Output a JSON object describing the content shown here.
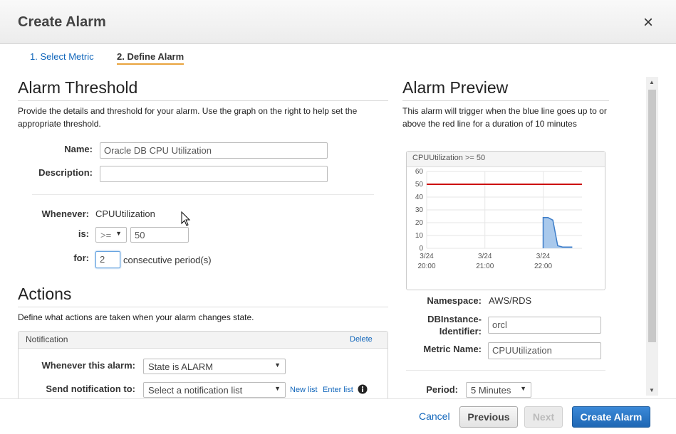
{
  "dialog": {
    "title": "Create Alarm",
    "close": "×"
  },
  "steps": [
    {
      "label": "1. Select Metric"
    },
    {
      "label": "2. Define Alarm"
    }
  ],
  "threshold": {
    "heading": "Alarm Threshold",
    "description": "Provide the details and threshold for your alarm. Use the graph on the right to help set the appropriate threshold.",
    "name_label": "Name:",
    "name_value": "Oracle DB CPU Utilization",
    "description_label": "Description:",
    "description_value": "",
    "whenever_label": "Whenever:",
    "whenever_value": "CPUUtilization",
    "is_label": "is:",
    "operator": ">=",
    "threshold_value": "50",
    "for_label": "for:",
    "periods_value": "2",
    "periods_suffix": "consecutive period(s)"
  },
  "actions": {
    "heading": "Actions",
    "description": "Define what actions are taken when your alarm changes state.",
    "notification": {
      "title": "Notification",
      "delete": "Delete",
      "whenever_label": "Whenever this alarm:",
      "state_value": "State is ALARM",
      "send_label": "Send notification to:",
      "send_value": "Select a notification list",
      "new_list": "New list",
      "enter_list": "Enter list"
    }
  },
  "preview": {
    "heading": "Alarm Preview",
    "description": "This alarm will trigger when the blue line goes up to or above the red line for a duration of 10 minutes",
    "namespace_label": "Namespace:",
    "namespace_value": "AWS/RDS",
    "dbinstance_label_1": "DBInstance-",
    "dbinstance_label_2": "Identifier:",
    "dbinstance_value": "orcl",
    "metric_label": "Metric Name:",
    "metric_value": "CPUUtilization",
    "period_label": "Period:",
    "period_value": "5 Minutes"
  },
  "footer": {
    "cancel": "Cancel",
    "previous": "Previous",
    "next": "Next",
    "create": "Create Alarm"
  },
  "colors": {
    "threshold_line": "#cc0000",
    "metric_line": "#3d7dc8",
    "metric_fill": "#a9c9ec",
    "accent_underline": "#e8a33d",
    "primary_button": "#2a75c4"
  },
  "chart_data": {
    "type": "area",
    "title": "CPUUtilization >= 50",
    "x_ticks": [
      {
        "date": "3/24",
        "time": "20:00"
      },
      {
        "date": "3/24",
        "time": "21:00"
      },
      {
        "date": "3/24",
        "time": "22:00"
      }
    ],
    "y_ticks": [
      0,
      10,
      20,
      30,
      40,
      50,
      60
    ],
    "ylim": [
      0,
      60
    ],
    "threshold": 50,
    "xlim": [
      "20:00",
      "22:40"
    ],
    "series": [
      {
        "points": [
          [
            "22:00",
            0
          ],
          [
            "22:00",
            24
          ],
          [
            "22:05",
            24
          ],
          [
            "22:10",
            22
          ],
          [
            "22:15",
            2
          ],
          [
            "22:20",
            1
          ],
          [
            "22:25",
            1
          ],
          [
            "22:30",
            1
          ]
        ]
      }
    ],
    "grid": true
  }
}
